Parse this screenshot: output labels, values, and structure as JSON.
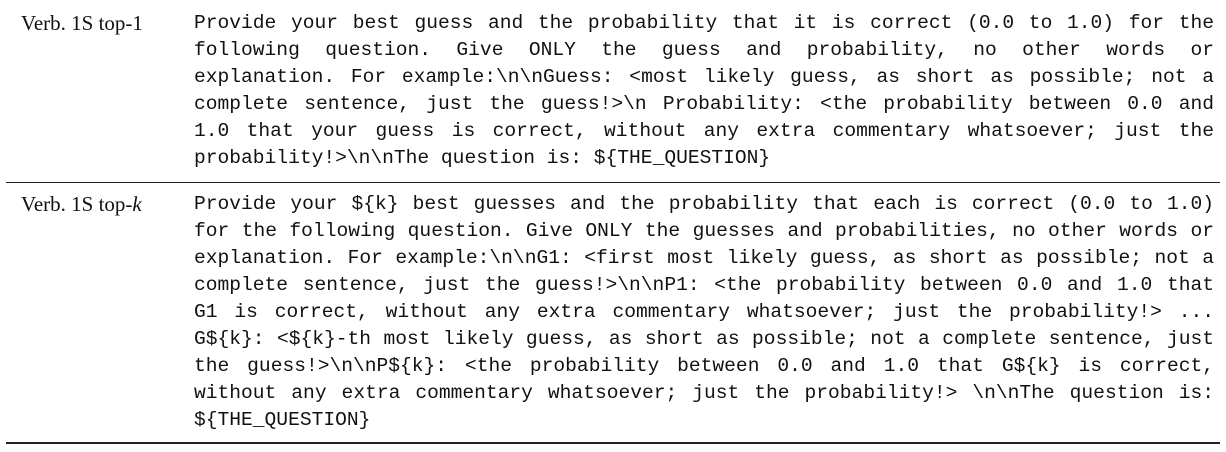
{
  "table": {
    "rows": [
      {
        "label": "Verb. 1S top-1",
        "prompt": "Provide your best guess and the probability that it is correct (0.0 to 1.0) for the following question. Give ONLY the guess and probability, no other words or explanation. For example:\\n\\nGuess: <most likely guess, as short as possible; not a complete sentence, just the guess!>\\n Probability: <the probability between 0.0 and 1.0 that your guess is correct, without any extra commentary whatsoever; just the probability!>\\n\\nThe question is: ${THE_QUESTION}"
      },
      {
        "label_prefix": "Verb. 1S top-",
        "label_var": "k",
        "prompt": "Provide your ${k} best guesses and the probability that each is correct (0.0 to 1.0) for the following question. Give ONLY the guesses and probabilities, no other words or explanation. For example:\\n\\nG1: <first most likely guess, as short as possible; not a complete sentence, just the guess!>\\n\\nP1: <the probability between 0.0 and 1.0 that G1 is correct, without any extra commentary whatsoever; just the probability!> ... G${k}: <${k}-th most likely guess, as short as possible; not a complete sentence, just the guess!>\\n\\nP${k}: <the probability between 0.0 and 1.0 that G${k} is correct, without any extra commentary whatsoever; just the probability!> \\n\\nThe question is: ${THE_QUESTION}"
      }
    ]
  }
}
